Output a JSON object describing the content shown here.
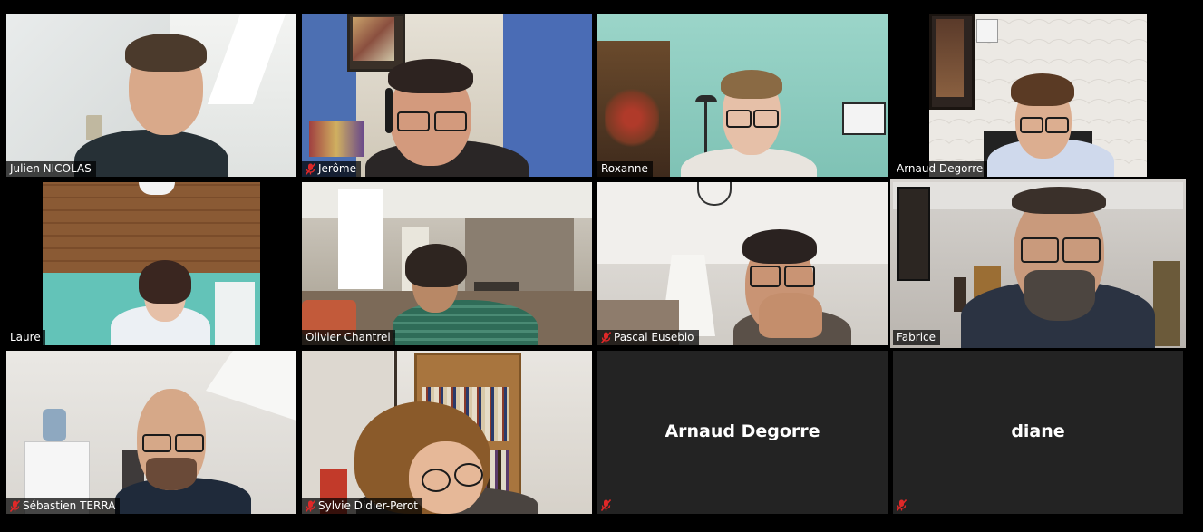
{
  "participants": [
    {
      "name": "Julien NICOLAS",
      "muted": false,
      "video": true
    },
    {
      "name": "Jerôme",
      "muted": true,
      "video": true
    },
    {
      "name": "Roxanne",
      "muted": false,
      "video": true
    },
    {
      "name": "Arnaud Degorre",
      "muted": false,
      "video": true
    },
    {
      "name": "Laure",
      "muted": false,
      "video": true
    },
    {
      "name": "Olivier Chantrel",
      "muted": false,
      "video": true
    },
    {
      "name": "Pascal Eusebio",
      "muted": true,
      "video": true
    },
    {
      "name": "Fabrice",
      "muted": false,
      "video": true,
      "speaking": true
    },
    {
      "name": "Sébastien TERRA",
      "muted": true,
      "video": true
    },
    {
      "name": "Sylvie Didier-Perot",
      "muted": true,
      "video": true
    },
    {
      "name": "Arnaud Degorre",
      "muted": true,
      "video": false
    },
    {
      "name": "diane",
      "muted": true,
      "video": false
    }
  ],
  "colors": {
    "active_speaker_border": "#c9e265",
    "muted_icon": "#e02828",
    "tile_bg_no_video": "#232323"
  },
  "icons": {
    "muted": "microphone-muted-icon"
  }
}
